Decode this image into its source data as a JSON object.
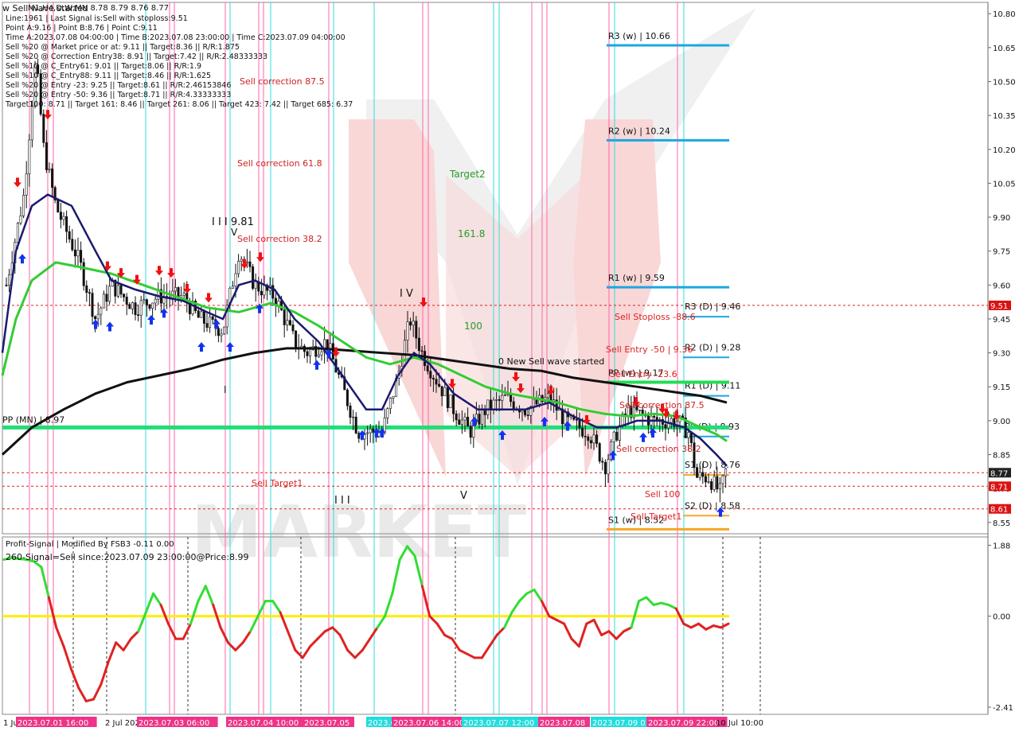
{
  "window": {
    "title": "w Sell wave started",
    "symbol_line": "M1,H4,D,W,MN 8.78 8.79 8.76 8.77"
  },
  "info_lines": [
    "Line:1961 | Last Signal is:Sell with stoploss:9.51",
    "Point A:9.16 | Point B:8.76 | Point C:9.11",
    "Time A:2023.07.08 04:00:00 | Time B:2023.07.08 23:00:00 | Time C:2023.07.09 04:00:00",
    "Sell %20 @ Market price or at: 9.11 || Target:8.36 || R/R:1.875",
    "Sell %20 @ Correction Entry38: 8.91 || Target:7.42 || R/R:2.48333333",
    "Sell %10 @ C_Entry61: 9.01 || Target:8.06 || R/R:1.9",
    "Sell %10 @ C_Entry88: 9.11 || Target:8.46 || R/R:1.625",
    "Sell %20 @ Entry -23: 9.25 || Target:8.61 || R/R:2.46153846",
    "Sell %20 @ Entry -50: 9.36 || Target:8.71 || R/R:4.33333333",
    "Target100: 8.71 || Target 161: 8.46 || Target 261: 8.06 || Target 423: 7.42 || Target 685: 6.37"
  ],
  "chart_data": {
    "type": "candlestick",
    "price_axis": {
      "min": 8.5,
      "max": 10.85,
      "ticks": [
        "10.80",
        "10.65",
        "10.50",
        "10.35",
        "10.20",
        "10.05",
        "9.90",
        "9.75",
        "9.60",
        "9.45",
        "9.30",
        "9.15",
        "9.00",
        "8.85",
        "8.70",
        "8.55"
      ],
      "tick_values": [
        10.8,
        10.65,
        10.5,
        10.35,
        10.2,
        10.05,
        9.9,
        9.75,
        9.6,
        9.45,
        9.3,
        9.15,
        9.0,
        8.85,
        8.7,
        8.55
      ]
    },
    "price_tags": [
      {
        "label": "9.51",
        "value": 9.51,
        "color": "#dd1111"
      },
      {
        "label": "8.77",
        "value": 8.77,
        "color": "#222222"
      },
      {
        "label": "8.71",
        "value": 8.71,
        "color": "#dd1111"
      },
      {
        "label": "8.61",
        "value": 8.61,
        "color": "#dd1111"
      }
    ],
    "level_lines": [
      {
        "label": "R3 (w) | 10.66",
        "value": 10.66,
        "color": "#1ba7e0"
      },
      {
        "label": "R2 (w) | 10.24",
        "value": 10.24,
        "color": "#1ba7e0"
      },
      {
        "label": "R1 (w) | 9.59",
        "value": 9.59,
        "color": "#1ba7e0"
      },
      {
        "label": "R3 (D) | 9.46",
        "value": 9.46,
        "color": "#1ba7e0"
      },
      {
        "label": "R2 (D) | 9.28",
        "value": 9.28,
        "color": "#1ba7e0"
      },
      {
        "label": "R1 (D) | 9.11",
        "value": 9.11,
        "color": "#1ba7e0"
      },
      {
        "label": "PP (D) | 8.93",
        "value": 8.93,
        "color": "#1ba7e0"
      },
      {
        "label": "S1 (D) | 8.76",
        "value": 8.76,
        "color": "#f5a623"
      },
      {
        "label": "S2 (D) | 8.58",
        "value": 8.58,
        "color": "#f5a623"
      },
      {
        "label": "S1 (w) | 8.52",
        "value": 8.52,
        "color": "#f5a623"
      },
      {
        "label": "PP (w) | 9.17",
        "value": 9.17,
        "color": "#22dd55"
      },
      {
        "label": "PP (MN) | 8.97",
        "value": 8.97,
        "color": "#22dd77"
      }
    ],
    "dashed_levels": [
      9.51,
      8.77,
      8.71,
      8.61
    ],
    "annotations": [
      {
        "text": "Sell correction 87.5",
        "color": "#cc2222"
      },
      {
        "text": "Sell correction 61.8",
        "color": "#cc2222"
      },
      {
        "text": "Sell correction 38.2",
        "color": "#cc2222"
      },
      {
        "text": "Target2",
        "color": "#2a9a2a"
      },
      {
        "text": "161.8",
        "color": "#2a9a2a"
      },
      {
        "text": "100",
        "color": "#2a9a2a"
      },
      {
        "text": "I I I 9.81",
        "color": "#111111"
      },
      {
        "text": "I V",
        "color": "#111111"
      },
      {
        "text": "V",
        "color": "#111111"
      },
      {
        "text": "I I I",
        "color": "#111111"
      },
      {
        "text": "V",
        "color": "#111111"
      },
      {
        "text": "I",
        "color": "#111111"
      },
      {
        "text": "0 New Sell wave started",
        "color": "#111111"
      },
      {
        "text": "Sell Stoploss -88.6",
        "color": "#dd2222"
      },
      {
        "text": "Sell Entry -50 | 9.36",
        "color": "#dd2222"
      },
      {
        "text": "Sell Entry -23.6",
        "color": "#dd2222"
      },
      {
        "text": "Sell correction 87.5",
        "color": "#cc2222"
      },
      {
        "text": "Sell correction 38.2",
        "color": "#cc2222"
      },
      {
        "text": "Sell 100",
        "color": "#dd2222"
      },
      {
        "text": "Sell Target1",
        "color": "#dd2222"
      },
      {
        "text": "Sell Target1",
        "color": "#dd2222"
      }
    ],
    "time_labels": [
      {
        "text": "1 Jul 2023",
        "bg": ""
      },
      {
        "text": "2023.07.01 16:00",
        "bg": "#ee3388"
      },
      {
        "text": "2 Jul 2023",
        "bg": ""
      },
      {
        "text": "2023.07.03 06:00",
        "bg": "#ee3388"
      },
      {
        "text": "2023.07.04 10:00",
        "bg": "#ee3388"
      },
      {
        "text": "2023.07.05",
        "bg": "#ee3388"
      },
      {
        "text": "2023.07.05",
        "bg": "#22dddd"
      },
      {
        "text": "2023.07.06 14:00",
        "bg": "#ee3388"
      },
      {
        "text": "2023.07.07 12:00",
        "bg": "#22dddd"
      },
      {
        "text": "2023.07.08",
        "bg": "#ee3388"
      },
      {
        "text": "2023.07.09 02:00",
        "bg": "#22dddd"
      },
      {
        "text": "2023.07.09 22:00",
        "bg": "#ee3388"
      },
      {
        "text": "10 Jul 10:00",
        "bg": ""
      }
    ],
    "indicator": {
      "title": "Profit-Signal | Modified By FSB3 -0.11 0.00",
      "signal_text": "260-Signal=Sell since:2023.07.09 23:00:00@Price:8.99",
      "ticks": [
        "1.88",
        "0.00",
        "-2.41"
      ],
      "tick_values": [
        1.88,
        0.0,
        -2.41
      ],
      "zero_line_color": "#ffee00",
      "up_color": "#33dd33",
      "down_color": "#e02222",
      "samples": [
        1.5,
        1.55,
        1.52,
        1.5,
        1.45,
        1.3,
        0.5,
        -0.3,
        -0.8,
        -1.4,
        -1.9,
        -2.25,
        -2.2,
        -1.8,
        -1.2,
        -0.7,
        -0.9,
        -0.6,
        -0.4,
        0.1,
        0.6,
        0.3,
        -0.2,
        -0.6,
        -0.6,
        -0.2,
        0.4,
        0.8,
        0.3,
        -0.3,
        -0.7,
        -0.9,
        -0.7,
        -0.4,
        0.0,
        0.4,
        0.4,
        0.1,
        -0.4,
        -0.9,
        -1.1,
        -0.8,
        -0.6,
        -0.4,
        -0.3,
        -0.5,
        -0.9,
        -1.1,
        -0.9,
        -0.6,
        -0.3,
        0.0,
        0.6,
        1.5,
        1.85,
        1.6,
        0.8,
        0.0,
        -0.2,
        -0.5,
        -0.6,
        -0.9,
        -1.0,
        -1.1,
        -1.1,
        -0.8,
        -0.5,
        -0.3,
        0.1,
        0.4,
        0.6,
        0.7,
        0.4,
        0.0,
        -0.1,
        -0.2,
        -0.6,
        -0.8,
        -0.2,
        -0.1,
        -0.5,
        -0.4,
        -0.6,
        -0.4,
        -0.3,
        0.4,
        0.5,
        0.3,
        0.35,
        0.3,
        0.2,
        -0.2,
        -0.3,
        -0.2,
        -0.35,
        -0.25,
        -0.3,
        -0.2
      ]
    }
  },
  "colors": {
    "bear_arrow": "#ee1111",
    "bull_arrow": "#1133ee",
    "ma_navy": "#1a1a6e",
    "ma_green": "#33cc33",
    "ma_black": "#111111",
    "pink_vline": "#ff66aa",
    "cyan_vline": "#33dddd"
  }
}
